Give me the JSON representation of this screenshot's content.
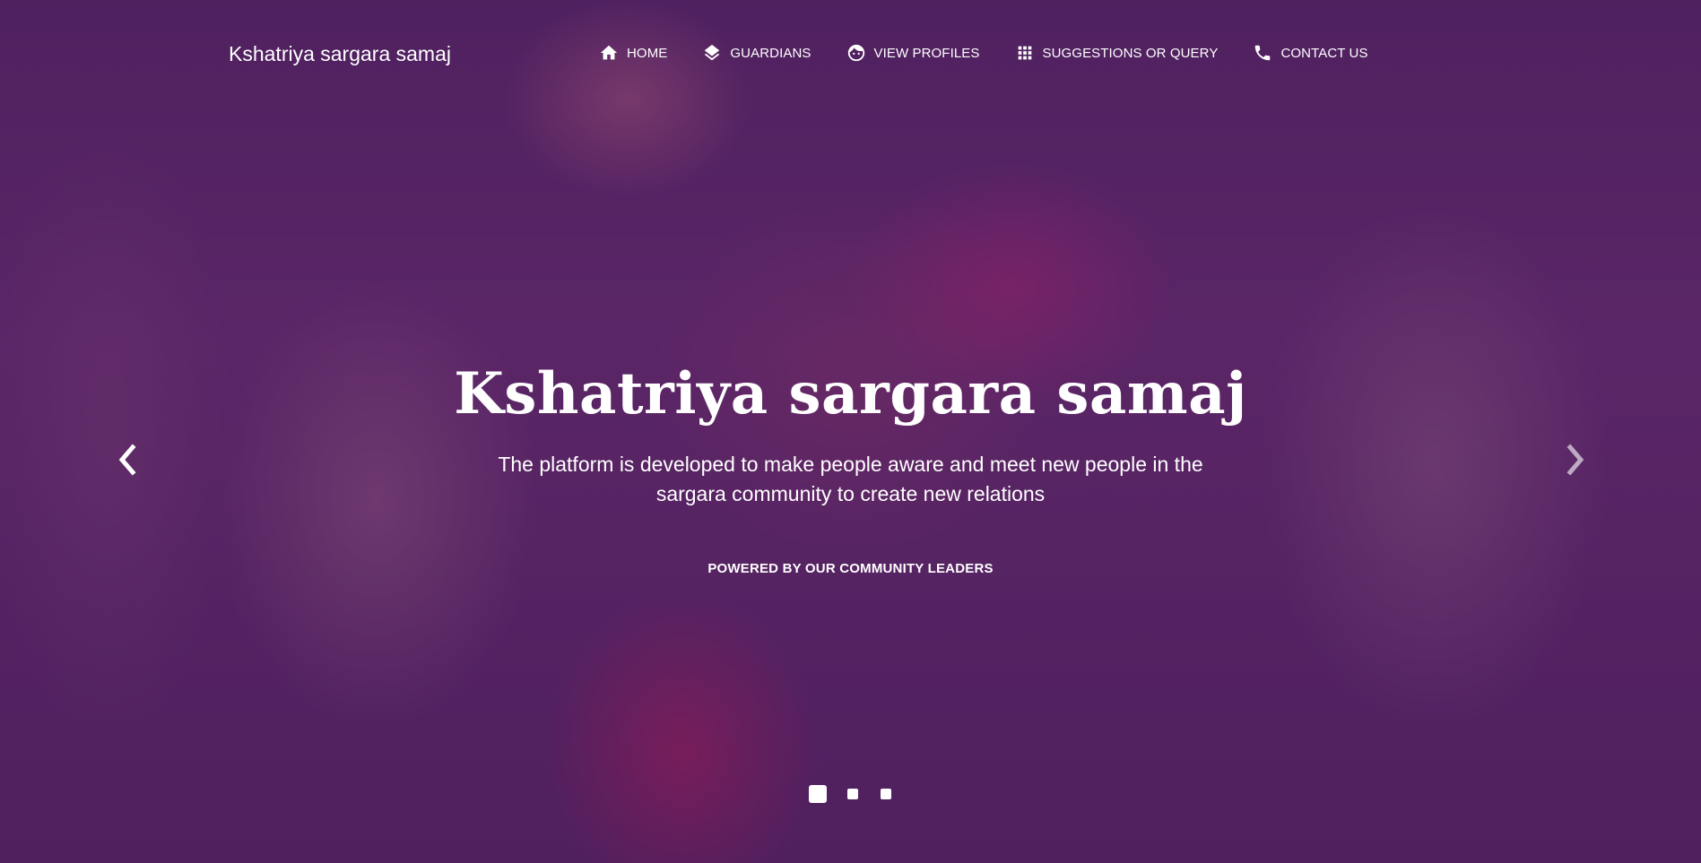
{
  "nav": {
    "brand": "Kshatriya sargara samaj",
    "items": [
      {
        "label": "HOME",
        "icon": "home-icon"
      },
      {
        "label": "GUARDIANS",
        "icon": "layers-icon"
      },
      {
        "label": "VIEW PROFILES",
        "icon": "face-icon"
      },
      {
        "label": "SUGGESTIONS OR QUERY",
        "icon": "apps-grid-icon"
      },
      {
        "label": "CONTACT US",
        "icon": "phone-icon"
      }
    ]
  },
  "hero": {
    "title": "Kshatriya sargara samaj",
    "subtitle": "The platform is developed to make people aware and meet new people in the sargara community to create new relations",
    "powered_by": "POWERED BY OUR COMMUNITY LEADERS"
  },
  "carousel": {
    "slide_count": 3,
    "active_index": 0,
    "prev_icon": "chevron-left-icon",
    "next_icon": "chevron-right-icon"
  },
  "colors": {
    "overlay": "#5a2868",
    "text": "#ffffff"
  }
}
